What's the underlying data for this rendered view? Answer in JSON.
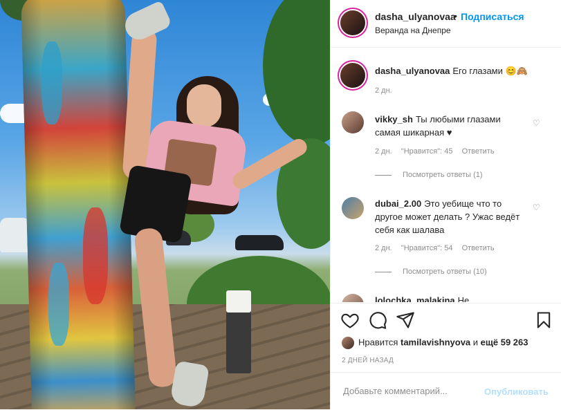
{
  "header": {
    "username": "dasha_ulyanovaa",
    "dot": "•",
    "follow_label": "Подписаться",
    "location": "Веранда на Днепре"
  },
  "caption": {
    "username": "dasha_ulyanovaa",
    "text": "Его глазами 😊🙈",
    "time": "2 дн."
  },
  "comments": [
    {
      "username": "vikky_sh",
      "text": "Ты любыми глазами самая шикарная ♥",
      "time": "2 дн.",
      "likes": "\"Нравится\": 45",
      "reply_label": "Ответить",
      "view_replies": "Посмотреть ответы (1)"
    },
    {
      "username": "dubai_2.00",
      "text": "Это уебище что то другое может делать ? Ужас ведёт себя как шалава",
      "time": "2 дн.",
      "likes": "\"Нравится\": 54",
      "reply_label": "Ответить",
      "view_replies": "Посмотреть ответы (10)"
    },
    {
      "username": "lolochka_malakina",
      "text": "Не"
    }
  ],
  "likes": {
    "prefix": "Нравится",
    "user": "tamilavishnyova",
    "and": "и",
    "more": "ещё 59 263"
  },
  "date": "2 ДНЕЙ НАЗАД",
  "add_comment": {
    "placeholder": "Добавьте комментарий...",
    "post_label": "Опубликовать"
  },
  "icons": [
    "heart-icon",
    "comment-icon",
    "share-icon",
    "bookmark-icon"
  ]
}
